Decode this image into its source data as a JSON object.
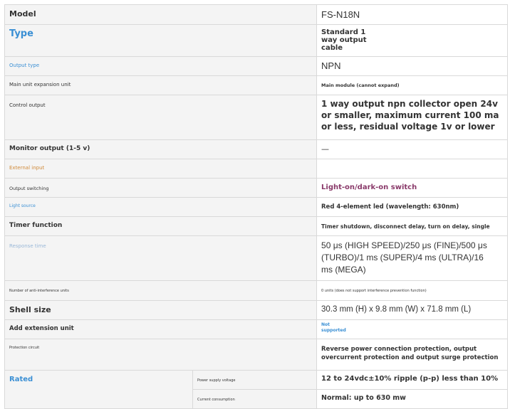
{
  "rows": [
    {
      "label": "Model",
      "value": "FS-N18N"
    },
    {
      "label": "Type",
      "value_lines": [
        "Standard 1",
        "way output",
        "cable"
      ]
    },
    {
      "label": "Output type",
      "value": "NPN"
    },
    {
      "label": "Main unit expansion unit",
      "value": "Main module (cannot expand)"
    },
    {
      "label": "Control output",
      "value_lines": [
        "1 way output npn collector open 24v",
        "or smaller, maximum current 100 ma",
        "or less, residual voltage 1v or lower"
      ]
    },
    {
      "label": "Monitor output (1-5 v)",
      "value": "—"
    },
    {
      "label": "External input",
      "value": ""
    },
    {
      "label": "Output switching",
      "value": "Light-on/dark-on switch"
    },
    {
      "label": "Light source",
      "value": "Red 4-element led (wavelength: 630nm)"
    },
    {
      "label": "Timer function",
      "value": "Timer shutdown, disconnect delay, turn on delay, single"
    },
    {
      "label": "Response time",
      "value_lines": [
        "50 μs (HIGH SPEED)/250 μs (FINE)/500 μs",
        "(TURBO)/1 ms (SUPER)/4 ms (ULTRA)/16",
        "ms (MEGA)"
      ]
    },
    {
      "label": "Number of anti-interference units",
      "value": "0 units (does not support interference prevention function)"
    },
    {
      "label": "Shell size",
      "value": "30.3 mm (H) x 9.8 mm (W) x 71.8 mm (L)"
    },
    {
      "label": "Add extension unit",
      "value_lines": [
        "Not",
        "supported"
      ]
    },
    {
      "label": "Protection circuit",
      "value_lines": [
        "Reverse power connection protection, output",
        "overcurrent protection and output surge protection"
      ]
    },
    {
      "label": "Rated",
      "sub": [
        {
          "label": "Power supply voltage",
          "value": "12 to 24vdc±10% ripple (p-p) less than 10%"
        },
        {
          "label": "Current consumption",
          "value": "Normal: up to 630 mw"
        }
      ]
    }
  ]
}
